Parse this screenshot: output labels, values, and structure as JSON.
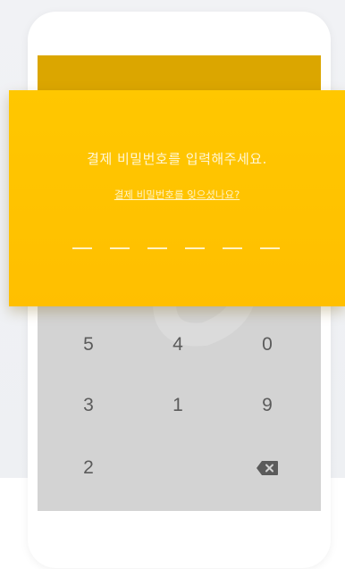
{
  "pin_dialog": {
    "title": "결제 비밀번호를 입력해주세요.",
    "forgot_link": "결제 비밀번호를 잊으셨나요?",
    "pin_length": 6
  },
  "keypad": {
    "keys": [
      "5",
      "4",
      "0",
      "3",
      "1",
      "9",
      "2",
      "",
      "backspace-icon"
    ]
  },
  "colors": {
    "card": "#ffc400",
    "screen_top": "#dba600",
    "keypad_bg": "#d3d3d3",
    "key_text": "#5b5b5b"
  }
}
